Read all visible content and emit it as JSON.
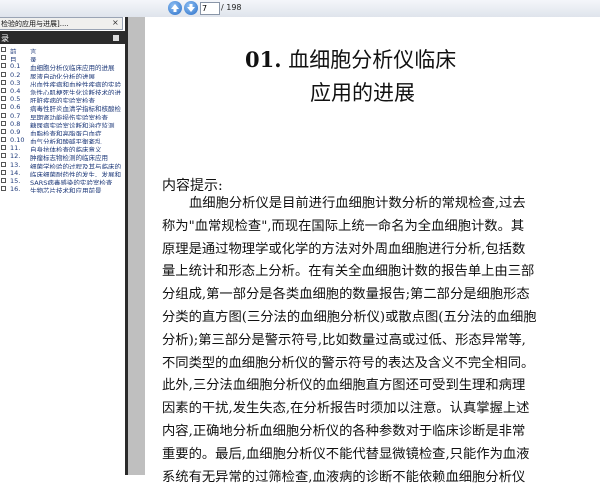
{
  "toolbar": {
    "page_current": "7",
    "page_total": "/ 198",
    "prev_icon": "arrow-up-icon",
    "next_icon": "arrow-down-icon"
  },
  "document_tab": {
    "label": "检验的应用与进展]....",
    "close_glyph": "×"
  },
  "bookmarks": {
    "title": "录",
    "items": [
      {
        "num": "前",
        "text": "言"
      },
      {
        "num": "目",
        "text": "录"
      },
      {
        "num": "0.1",
        "text": "血细胞分析仪临床应用的进展"
      },
      {
        "num": "0.2",
        "text": "尿液自动化分析的进展"
      },
      {
        "num": "0.3",
        "text": "出血性疾病和血栓性疾病的实验"
      },
      {
        "num": "0.4",
        "text": "急性心肌梗死生化诊断技术的进"
      },
      {
        "num": "0.5",
        "text": "肝脏疾病的实验室检查"
      },
      {
        "num": "0.6",
        "text": "病毒性肝炎血清学指标和核酸检"
      },
      {
        "num": "0.7",
        "text": "早期肾功能损伤实验室检查"
      },
      {
        "num": "0.8",
        "text": "糖尿病实验室诊断和治疗监测"
      },
      {
        "num": "0.9",
        "text": "血脂检查和高脂蛋白血症"
      },
      {
        "num": "0.10",
        "text": "血气分析和酸碱平衡紊乱"
      },
      {
        "num": "11.",
        "text": "自身抗体检查的临床意义"
      },
      {
        "num": "12.",
        "text": "肿瘤标志物检测的临床应用"
      },
      {
        "num": "13.",
        "text": "细菌学检验的过程及其与临床的"
      },
      {
        "num": "14.",
        "text": "临床细菌耐药性的发生、发展和"
      },
      {
        "num": "15.",
        "text": "SARS病毒感染的实验室检查"
      },
      {
        "num": "16.",
        "text": "生物芯片技术和应用前景"
      }
    ]
  },
  "page": {
    "title_num": "01.",
    "title_line1": "血细胞分析仪临床",
    "title_line2": "应用的进展",
    "summary_label": "内容提示:",
    "body_lines": [
      "血细胞分析仪是目前进行血细胞计数分析的常规检查,过去",
      "称为\"血常规检查\",而现在国际上统一命名为全血细胞计数。其",
      "原理是通过物理学或化学的方法对外周血细胞进行分析,包括数",
      "量上统计和形态上分析。在有关全血细胞计数的报告单上由三部",
      "分组成,第一部分是各类血细胞的数量报告;第二部分是细胞形态",
      "分类的直方图(三分法的血细胞分析仪)或散点图(五分法的血细胞",
      "分析);第三部分是警示符号,比如数量过高或过低、形态异常等,",
      "不同类型的血细胞分析仪的警示符号的表达及含义不完全相同。",
      "此外,三分法血细胞分析仪的血细胞直方图还可受到生理和病理",
      "因素的干扰,发生失态,在分析报告时须加以注意。认真掌握上述",
      "内容,正确地分析血细胞分析仪的各种参数对于临床诊断是非常",
      "重要的。最后,血细胞分析仪不能代替显微镜检查,只能作为血液",
      "系统有无异常的过筛检查,血液病的诊断不能依赖血细胞分析仪"
    ]
  }
}
